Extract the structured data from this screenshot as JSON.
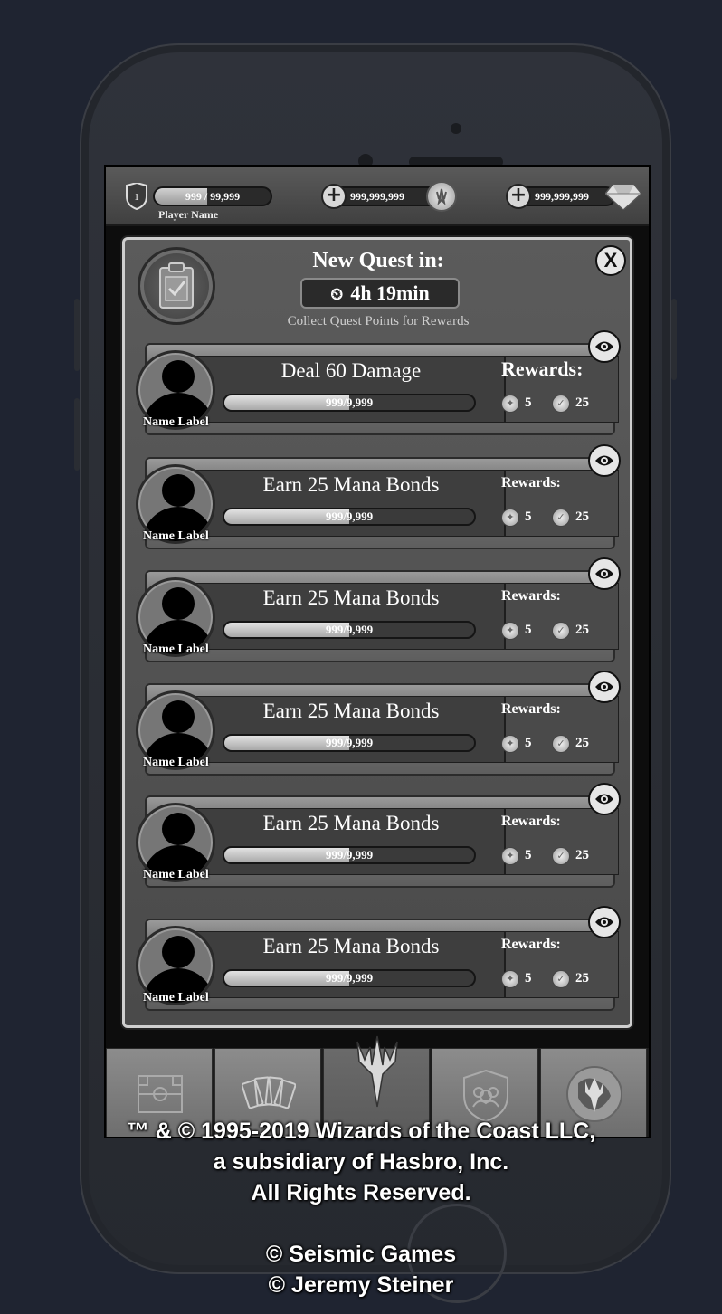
{
  "topbar": {
    "level": "1",
    "xp_text": "999 / 99,999",
    "xp_fraction": 0.45,
    "player_name": "Player Name",
    "currency1": "999,999,999",
    "currency2": "999,999,999"
  },
  "panel": {
    "new_quest_label": "New Quest in:",
    "timer": "4h 19min",
    "subtitle": "Collect Quest Points for Rewards",
    "close_label": "X",
    "rewards_label": "Rewards:",
    "quests": [
      {
        "title": "Deal 60 Damage",
        "progress_text": "999/9,999",
        "progress_fraction": 0.5,
        "name_label": "Name Label",
        "reward1": "5",
        "reward2": "25"
      },
      {
        "title": "Earn 25 Mana Bonds",
        "progress_text": "999/9,999",
        "progress_fraction": 0.5,
        "name_label": "Name Label",
        "reward1": "5",
        "reward2": "25"
      },
      {
        "title": "Earn 25 Mana Bonds",
        "progress_text": "999/9,999",
        "progress_fraction": 0.5,
        "name_label": "Name Label",
        "reward1": "5",
        "reward2": "25"
      },
      {
        "title": "Earn 25 Mana Bonds",
        "progress_text": "999/9,999",
        "progress_fraction": 0.5,
        "name_label": "Name Label",
        "reward1": "5",
        "reward2": "25"
      },
      {
        "title": "Earn 25 Mana Bonds",
        "progress_text": "999/9,999",
        "progress_fraction": 0.5,
        "name_label": "Name Label",
        "reward1": "5",
        "reward2": "25"
      },
      {
        "title": "Earn 25 Mana Bonds",
        "progress_text": "999/9,999",
        "progress_fraction": 0.5,
        "name_label": "Name Label",
        "reward1": "5",
        "reward2": "25"
      }
    ]
  },
  "nav": {
    "tabs": [
      "board-icon",
      "cards-icon",
      "planeswalker-icon",
      "guild-icon",
      "world-icon"
    ],
    "active_index": 2
  },
  "legal": {
    "line1": "™ & © 1995-2019 Wizards of the Coast LLC,",
    "line2": "a subsidiary of Hasbro, Inc.",
    "line3": "All Rights Reserved.",
    "line4": "© Seismic Games",
    "line5": "© Jeremy Steiner"
  }
}
